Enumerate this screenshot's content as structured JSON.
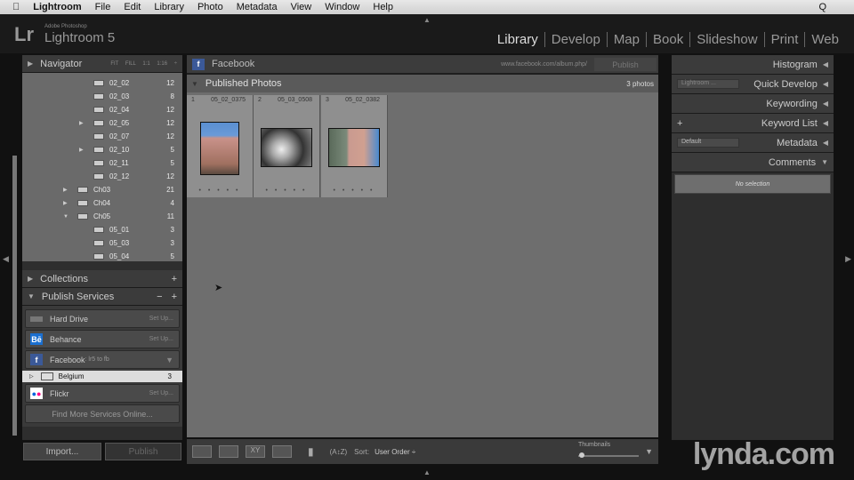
{
  "menubar": {
    "apple": "",
    "app": "Lightroom",
    "items": [
      "File",
      "Edit",
      "Library",
      "Photo",
      "Metadata",
      "View",
      "Window",
      "Help"
    ],
    "search": "Q"
  },
  "header": {
    "logo": "Lr",
    "brand_small": "Adobe Photoshop",
    "brand": "Lightroom 5",
    "modules": [
      "Library",
      "Develop",
      "Map",
      "Book",
      "Slideshow",
      "Print",
      "Web"
    ],
    "active_module": "Library"
  },
  "left": {
    "navigator": {
      "title": "Navigator",
      "zoom": [
        "FIT",
        "FILL",
        "1:1",
        "1:16 ÷"
      ]
    },
    "folders": [
      {
        "name": "02_02",
        "count": "12",
        "level": 2
      },
      {
        "name": "02_03",
        "count": "8",
        "level": 2
      },
      {
        "name": "02_04",
        "count": "12",
        "level": 2
      },
      {
        "name": "02_05",
        "count": "12",
        "level": 2,
        "expand": "▶"
      },
      {
        "name": "02_07",
        "count": "12",
        "level": 2
      },
      {
        "name": "02_10",
        "count": "5",
        "level": 2,
        "expand": "▶"
      },
      {
        "name": "02_11",
        "count": "5",
        "level": 2
      },
      {
        "name": "02_12",
        "count": "12",
        "level": 2
      },
      {
        "name": "Ch03",
        "count": "21",
        "level": 1,
        "expand": "▶"
      },
      {
        "name": "Ch04",
        "count": "4",
        "level": 1,
        "expand": "▶"
      },
      {
        "name": "Ch05",
        "count": "11",
        "level": 1,
        "expand": "▼"
      },
      {
        "name": "05_01",
        "count": "3",
        "level": 2
      },
      {
        "name": "05_03",
        "count": "3",
        "level": 2
      },
      {
        "name": "05_04",
        "count": "5",
        "level": 2
      }
    ],
    "collections": "Collections",
    "publish_services": "Publish Services",
    "services": [
      {
        "name": "Hard Drive",
        "action": "Set Up..."
      },
      {
        "name": "Behance",
        "action": "Set Up..."
      },
      {
        "name": "Facebook",
        "account": ": lr5 to fb"
      },
      {
        "name": "Flickr",
        "action": "Set Up..."
      }
    ],
    "belgium": {
      "name": "Belgium",
      "count": "3"
    },
    "find_more": "Find More Services Online...",
    "import": "Import...",
    "publish": "Publish"
  },
  "center": {
    "service": "Facebook",
    "url": "www.facebook.com/album.php/",
    "publish": "Publish",
    "section": "Published Photos",
    "count": "3 photos",
    "photos": [
      {
        "index": "1",
        "name": "05_02_0375"
      },
      {
        "index": "2",
        "name": "05_03_0508"
      },
      {
        "index": "3",
        "name": "05_02_0382"
      }
    ],
    "rating_dots": "• • • • •"
  },
  "toolbar": {
    "sort_label": "Sort:",
    "sort_value": "User Order ÷",
    "thumbnails": "Thumbnails"
  },
  "right": {
    "panels": [
      "Histogram",
      "Quick Develop",
      "Keywording",
      "Keyword List",
      "Metadata",
      "Comments"
    ],
    "quick_develop_preset": "Lightroom ...",
    "metadata_preset": "Default",
    "no_selection": "No selection"
  },
  "watermark": "lynda.com"
}
